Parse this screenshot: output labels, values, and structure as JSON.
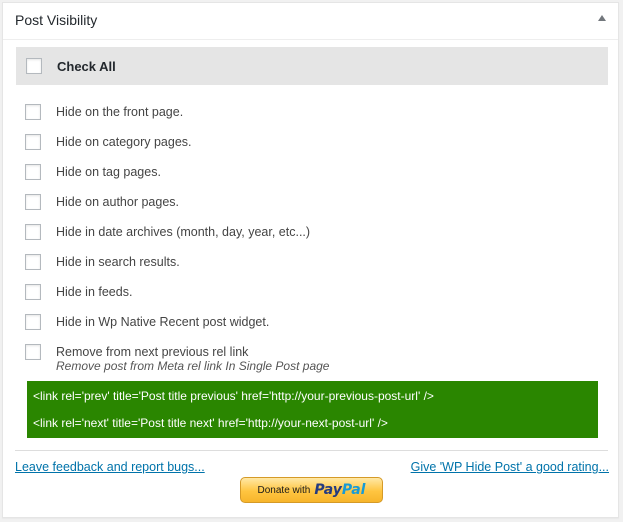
{
  "panel": {
    "title": "Post Visibility",
    "check_all_label": "Check All",
    "options": [
      "Hide on the front page.",
      "Hide on category pages.",
      "Hide on tag pages.",
      "Hide on author pages.",
      "Hide in date archives (month, day, year, etc...)",
      "Hide in search results.",
      "Hide in feeds.",
      "Hide in Wp Native Recent post widget.",
      "Remove from next previous rel link"
    ],
    "rel_description": "Remove post from Meta rel link In Single Post page",
    "code_lines": [
      "<link rel='prev' title='Post title previous' href='http://your-previous-post-url' />",
      "<link rel='next' title='Post title next' href='http://your-next-post-url' />"
    ]
  },
  "footer": {
    "feedback_link": "Leave feedback and report bugs...",
    "rating_link": "Give 'WP Hide Post' a good rating...",
    "donate_text": "Donate with",
    "paypal_pay": "Pay",
    "paypal_pal": "Pal"
  },
  "colors": {
    "code_bg": "#2a8600",
    "link": "#0073aa",
    "check_all_bg": "#e5e5e5"
  },
  "icons": {
    "toggle": "triangle-up-icon"
  }
}
